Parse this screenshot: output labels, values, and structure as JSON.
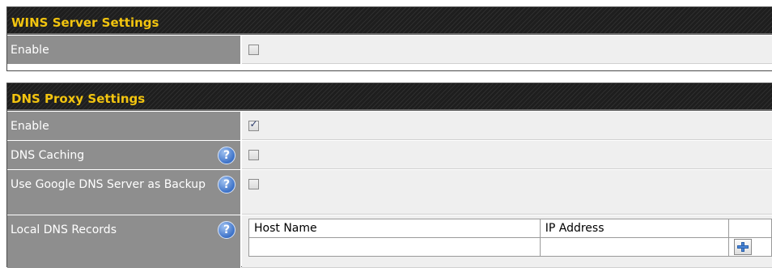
{
  "wins": {
    "title": "WINS Server Settings",
    "enable_label": "Enable",
    "enable_checked": false
  },
  "dns": {
    "title": "DNS Proxy Settings",
    "enable_label": "Enable",
    "enable_checked": true,
    "caching_label": "DNS Caching",
    "caching_checked": false,
    "google_label": "Use Google DNS Server as Backup",
    "google_checked": false,
    "records_label": "Local DNS Records",
    "records_columns": [
      "Host Name",
      "IP Address"
    ],
    "help_glyph": "?",
    "check_glyph": "✓",
    "icons": [
      "help-icon",
      "add-icon"
    ]
  }
}
